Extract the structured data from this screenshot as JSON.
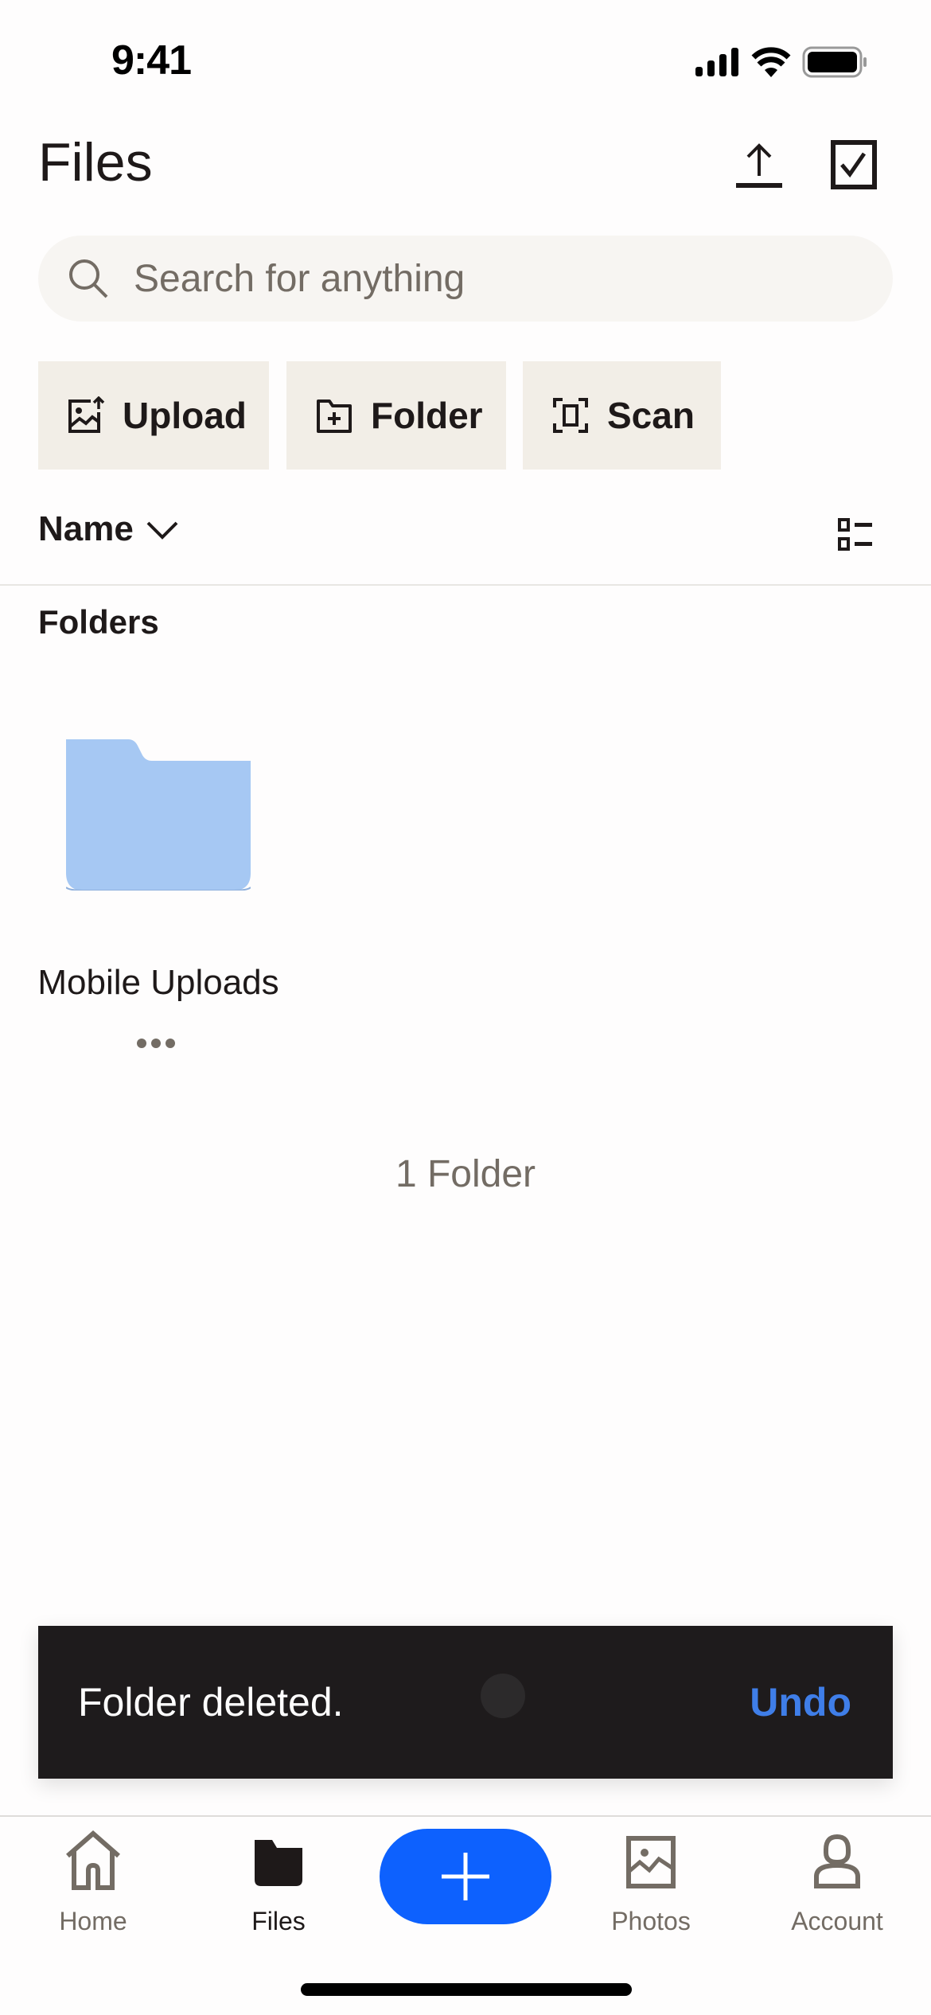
{
  "status_bar": {
    "time": "9:41"
  },
  "header": {
    "title": "Files",
    "upload_icon": "upload-icon",
    "select_icon": "checkbox-select-icon"
  },
  "search": {
    "placeholder": "Search for anything",
    "value": ""
  },
  "quick_actions": [
    {
      "label": "Upload",
      "icon": "upload-photo-icon"
    },
    {
      "label": "Folder",
      "icon": "new-folder-icon"
    },
    {
      "label": "Scan",
      "icon": "scan-icon"
    }
  ],
  "sort": {
    "label": "Name",
    "icon": "chevron-down-icon",
    "view_icon": "list-view-icon"
  },
  "section_title": "Folders",
  "folders": [
    {
      "name": "Mobile Uploads",
      "color": "#a6c8f3"
    }
  ],
  "count_text": "1 Folder",
  "snackbar": {
    "message": "Folder deleted.",
    "action": "Undo",
    "action_color": "#3f7ee8"
  },
  "nav": {
    "items": [
      {
        "label": "Home",
        "icon": "home-icon"
      },
      {
        "label": "Files",
        "icon": "folder-icon",
        "active": true
      },
      {
        "label": "Photos",
        "icon": "photos-icon"
      },
      {
        "label": "Account",
        "icon": "account-icon"
      }
    ],
    "fab_icon": "plus-icon",
    "accent": "#0d61fe"
  }
}
